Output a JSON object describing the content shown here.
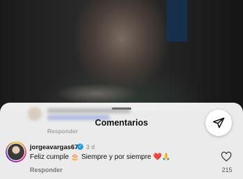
{
  "sheet": {
    "title": "Comentarios",
    "blurred_reply_label": "Responder"
  },
  "comment": {
    "username": "jorgeavargas67",
    "time": "3 d",
    "text": "Feliz cumple 🎂 Siempre y por siempre ❤️🙏",
    "reply_label": "Responder",
    "like_count": "215"
  },
  "icons": {
    "share": "paper-plane-icon",
    "like": "heart-outline-icon",
    "verified": "verified-badge-icon"
  },
  "colors": {
    "verified": "#1d9bf0",
    "sheet_bg": "#ffffff"
  }
}
